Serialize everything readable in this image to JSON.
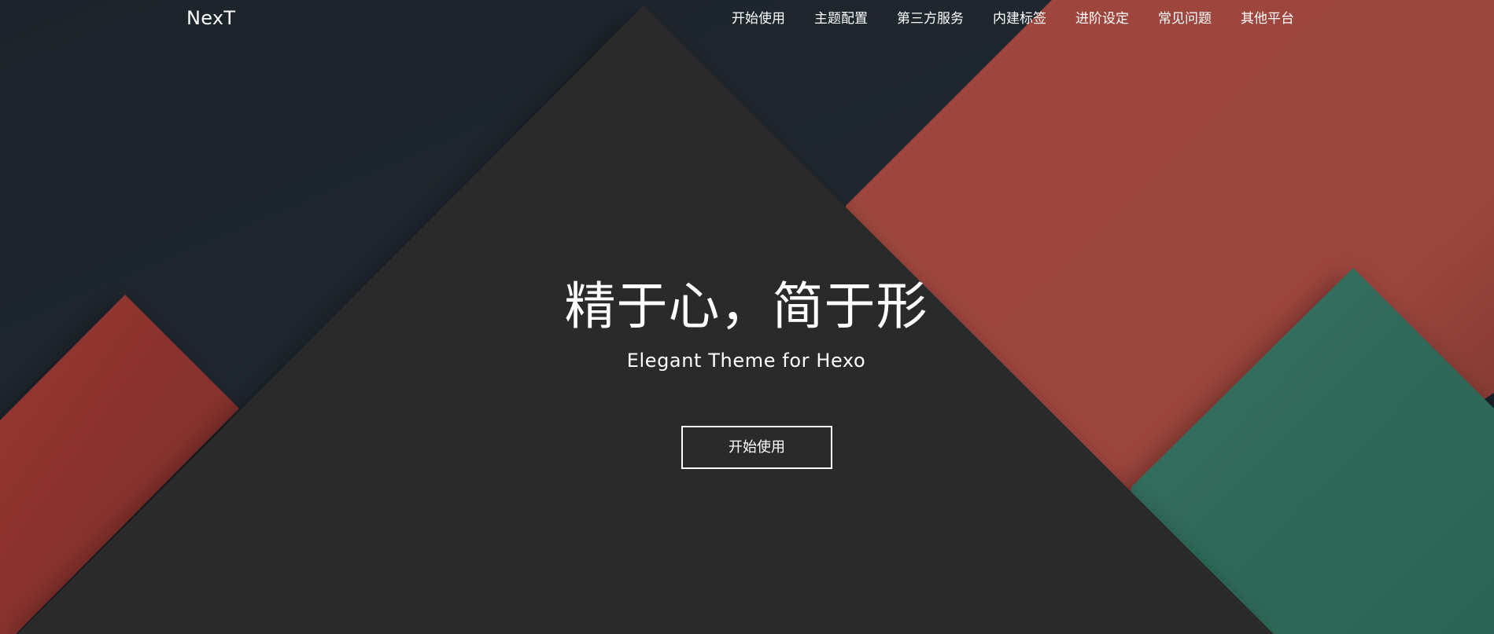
{
  "brand": {
    "name": "NexT"
  },
  "nav": {
    "items": [
      "开始使用",
      "主题配置",
      "第三方服务",
      "内建标签",
      "进阶设定",
      "常见问题",
      "其他平台"
    ]
  },
  "hero": {
    "title": "精于心，简于形",
    "subtitle": "Elegant Theme for Hexo",
    "cta_label": "开始使用"
  },
  "colors": {
    "background": "#1f252c",
    "dark_triangle": "#29292b",
    "red": "#9c463d",
    "left_red": "#923530",
    "green": "#2f6a59",
    "text": "#ffffff"
  }
}
